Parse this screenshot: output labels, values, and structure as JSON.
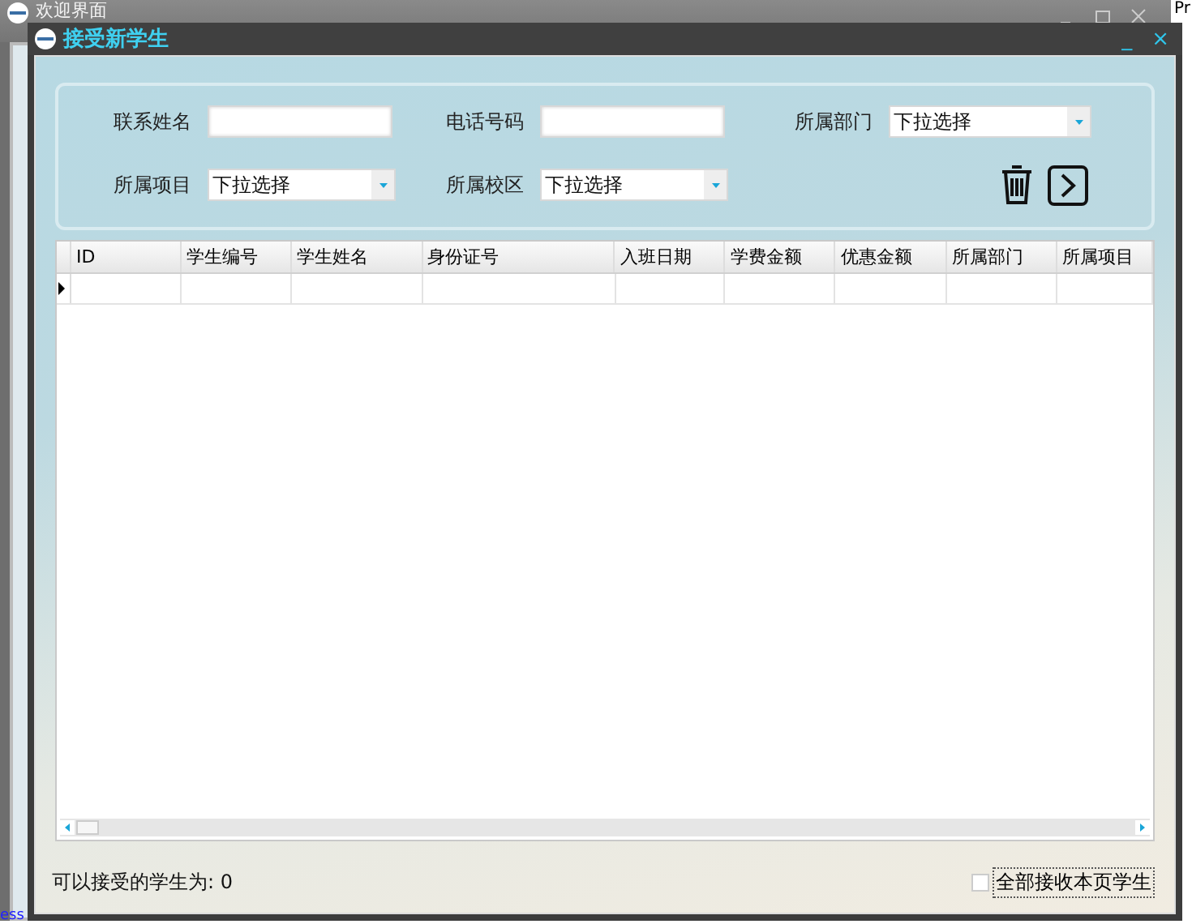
{
  "background_window": {
    "title": "欢迎界面",
    "side_text": "Pr",
    "status_text": "ess"
  },
  "dialog": {
    "title": "接受新学生",
    "minimize": "_",
    "close": "×"
  },
  "filters": [
    {
      "label": "联系姓名",
      "kind": "text"
    },
    {
      "label": "电话号码",
      "kind": "text"
    },
    {
      "label": "所属部门",
      "kind": "select",
      "value": "下拉选择"
    },
    {
      "label": "所属项目",
      "kind": "select",
      "value": "下拉选择"
    },
    {
      "label": "所属校区",
      "kind": "select",
      "value": "下拉选择"
    }
  ],
  "table": {
    "columns": [
      "ID",
      "学生编号",
      "学生姓名",
      "身份证号",
      "入班日期",
      "学费金额",
      "优惠金额",
      "所属部门",
      "所属项目"
    ],
    "rows": [
      {
        "current": true
      }
    ]
  },
  "footer": {
    "count_label": "可以接受的学生为: 0",
    "select_all": {
      "label": "全部接收本页学生",
      "checked": false
    }
  }
}
